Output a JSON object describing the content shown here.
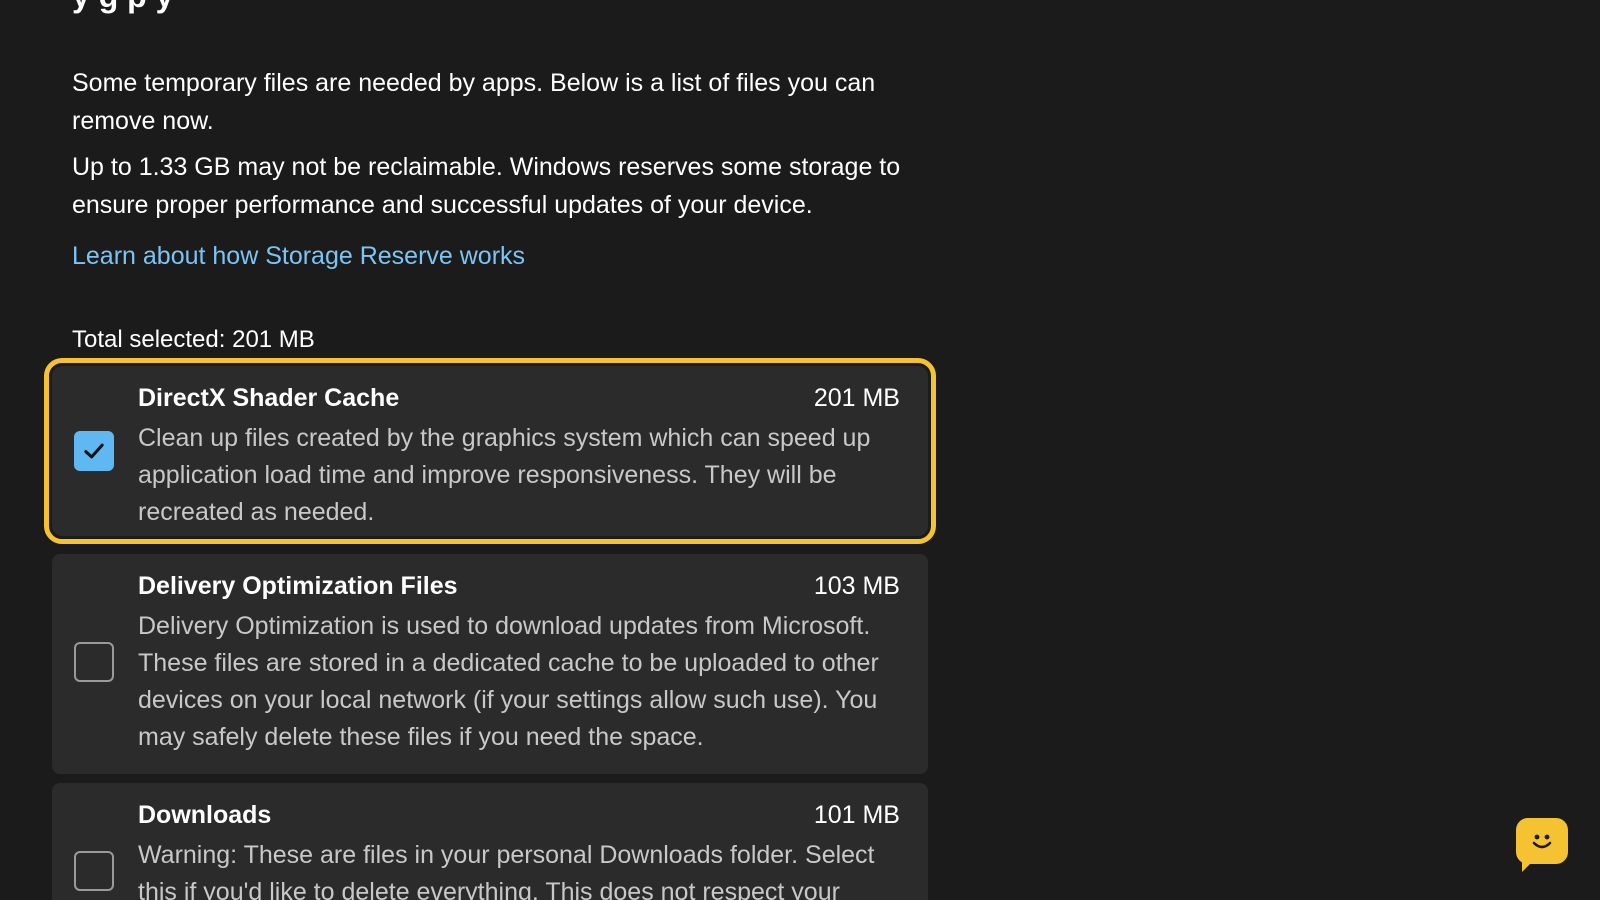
{
  "header": {
    "title_fragment": "y          g          p   y"
  },
  "intro": {
    "paragraph1": "Some temporary files are needed by apps. Below is a list of files you can remove now.",
    "paragraph2": "Up to 1.33 GB may not be reclaimable. Windows reserves some storage to ensure proper performance and successful updates of your device."
  },
  "learn_link": "Learn about how Storage Reserve works",
  "total_selected": "Total selected: 201 MB",
  "items": [
    {
      "name": "DirectX Shader Cache",
      "size": "201 MB",
      "checked": true,
      "description": "Clean up files created by the graphics system which can speed up application load time and improve responsiveness. They will be recreated as needed."
    },
    {
      "name": "Delivery Optimization Files",
      "size": "103 MB",
      "checked": false,
      "description": "Delivery Optimization is used to download updates from Microsoft. These files are stored in a dedicated cache to be uploaded to other devices on your local network (if your settings allow such use). You may safely delete these files if you need the space."
    },
    {
      "name": "Downloads",
      "size": "101 MB",
      "checked": false,
      "description": "Warning: These are files in your personal Downloads folder. Select this if you'd like to delete everything. This does not respect your"
    }
  ],
  "colors": {
    "accent": "#60b8f2",
    "focus_ring": "#f5c331",
    "link": "#7cc4f4"
  },
  "icons": {
    "checkmark": "checkmark-icon",
    "feedback": "feedback-smiley-icon"
  }
}
